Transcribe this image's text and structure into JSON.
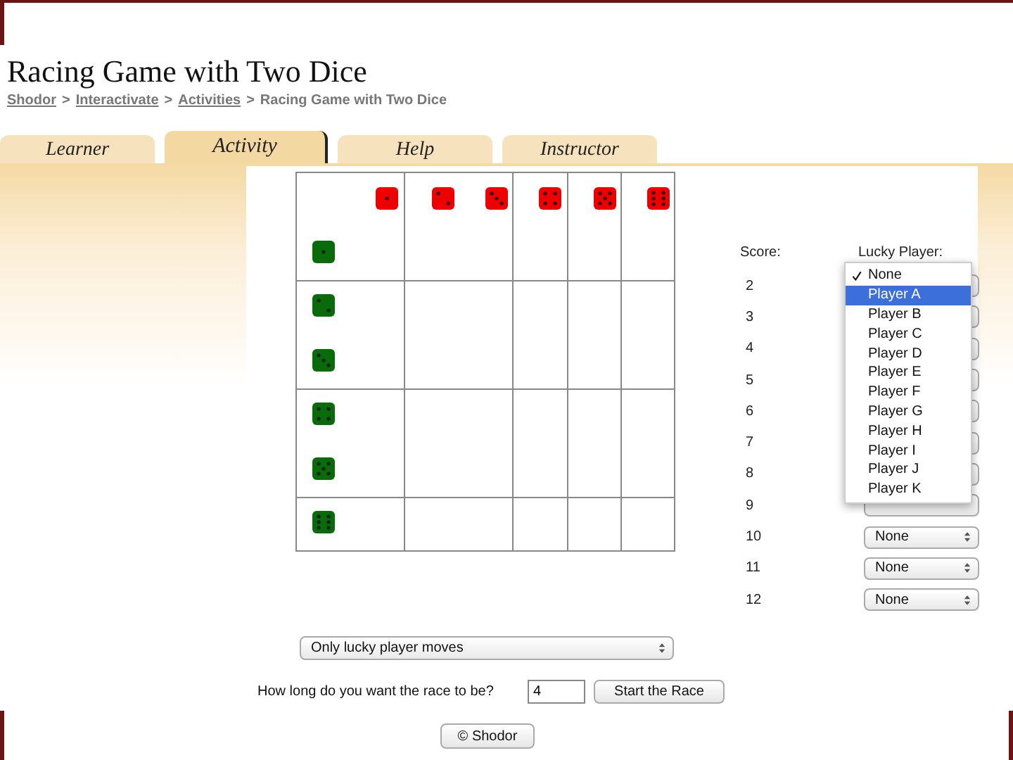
{
  "page": {
    "title": "Racing Game with Two Dice"
  },
  "breadcrumb": [
    {
      "kind": "link",
      "label": "Shodor"
    },
    {
      "kind": "separator",
      "label": ">"
    },
    {
      "kind": "link",
      "label": "Interactivate"
    },
    {
      "kind": "separator",
      "label": ">"
    },
    {
      "kind": "link",
      "label": "Activities"
    },
    {
      "kind": "separator",
      "label": ">"
    },
    {
      "kind": "current",
      "label": "Racing Game with Two Dice"
    }
  ],
  "tabs": [
    {
      "label": "Learner",
      "selected": false
    },
    {
      "label": "Activity",
      "selected": true
    },
    {
      "label": "Help",
      "selected": false
    },
    {
      "label": "Instructor",
      "selected": false
    }
  ],
  "score_panel": {
    "score_heading": "Score:",
    "player_heading": "Lucky Player:",
    "rows": [
      {
        "score": "2"
      },
      {
        "score": "3"
      },
      {
        "score": "4"
      },
      {
        "score": "5"
      },
      {
        "score": "6"
      },
      {
        "score": "7"
      },
      {
        "score": "8"
      },
      {
        "score": "9"
      },
      {
        "score": "10",
        "choice": "None"
      },
      {
        "score": "11",
        "choice": "None"
      },
      {
        "score": "12",
        "choice": "None"
      }
    ]
  },
  "player_menu": {
    "items": [
      {
        "label": "None",
        "checked": true,
        "selected": false
      },
      {
        "label": "Player A",
        "checked": false,
        "selected": true
      },
      {
        "label": "Player B",
        "checked": false,
        "selected": false
      },
      {
        "label": "Player C",
        "checked": false,
        "selected": false
      },
      {
        "label": "Player D",
        "checked": false,
        "selected": false
      },
      {
        "label": "Player E",
        "checked": false,
        "selected": false
      },
      {
        "label": "Player F",
        "checked": false,
        "selected": false
      },
      {
        "label": "Player G",
        "checked": false,
        "selected": false
      },
      {
        "label": "Player H",
        "checked": false,
        "selected": false
      },
      {
        "label": "Player I",
        "checked": false,
        "selected": false
      },
      {
        "label": "Player J",
        "checked": false,
        "selected": false
      },
      {
        "label": "Player K",
        "checked": false,
        "selected": false
      }
    ]
  },
  "mode_select": {
    "value": "Only lucky player moves"
  },
  "race_length": {
    "question": "How long do you want the race to be?",
    "value": "4"
  },
  "buttons": {
    "start": "Start the Race",
    "credit": "© Shodor"
  }
}
